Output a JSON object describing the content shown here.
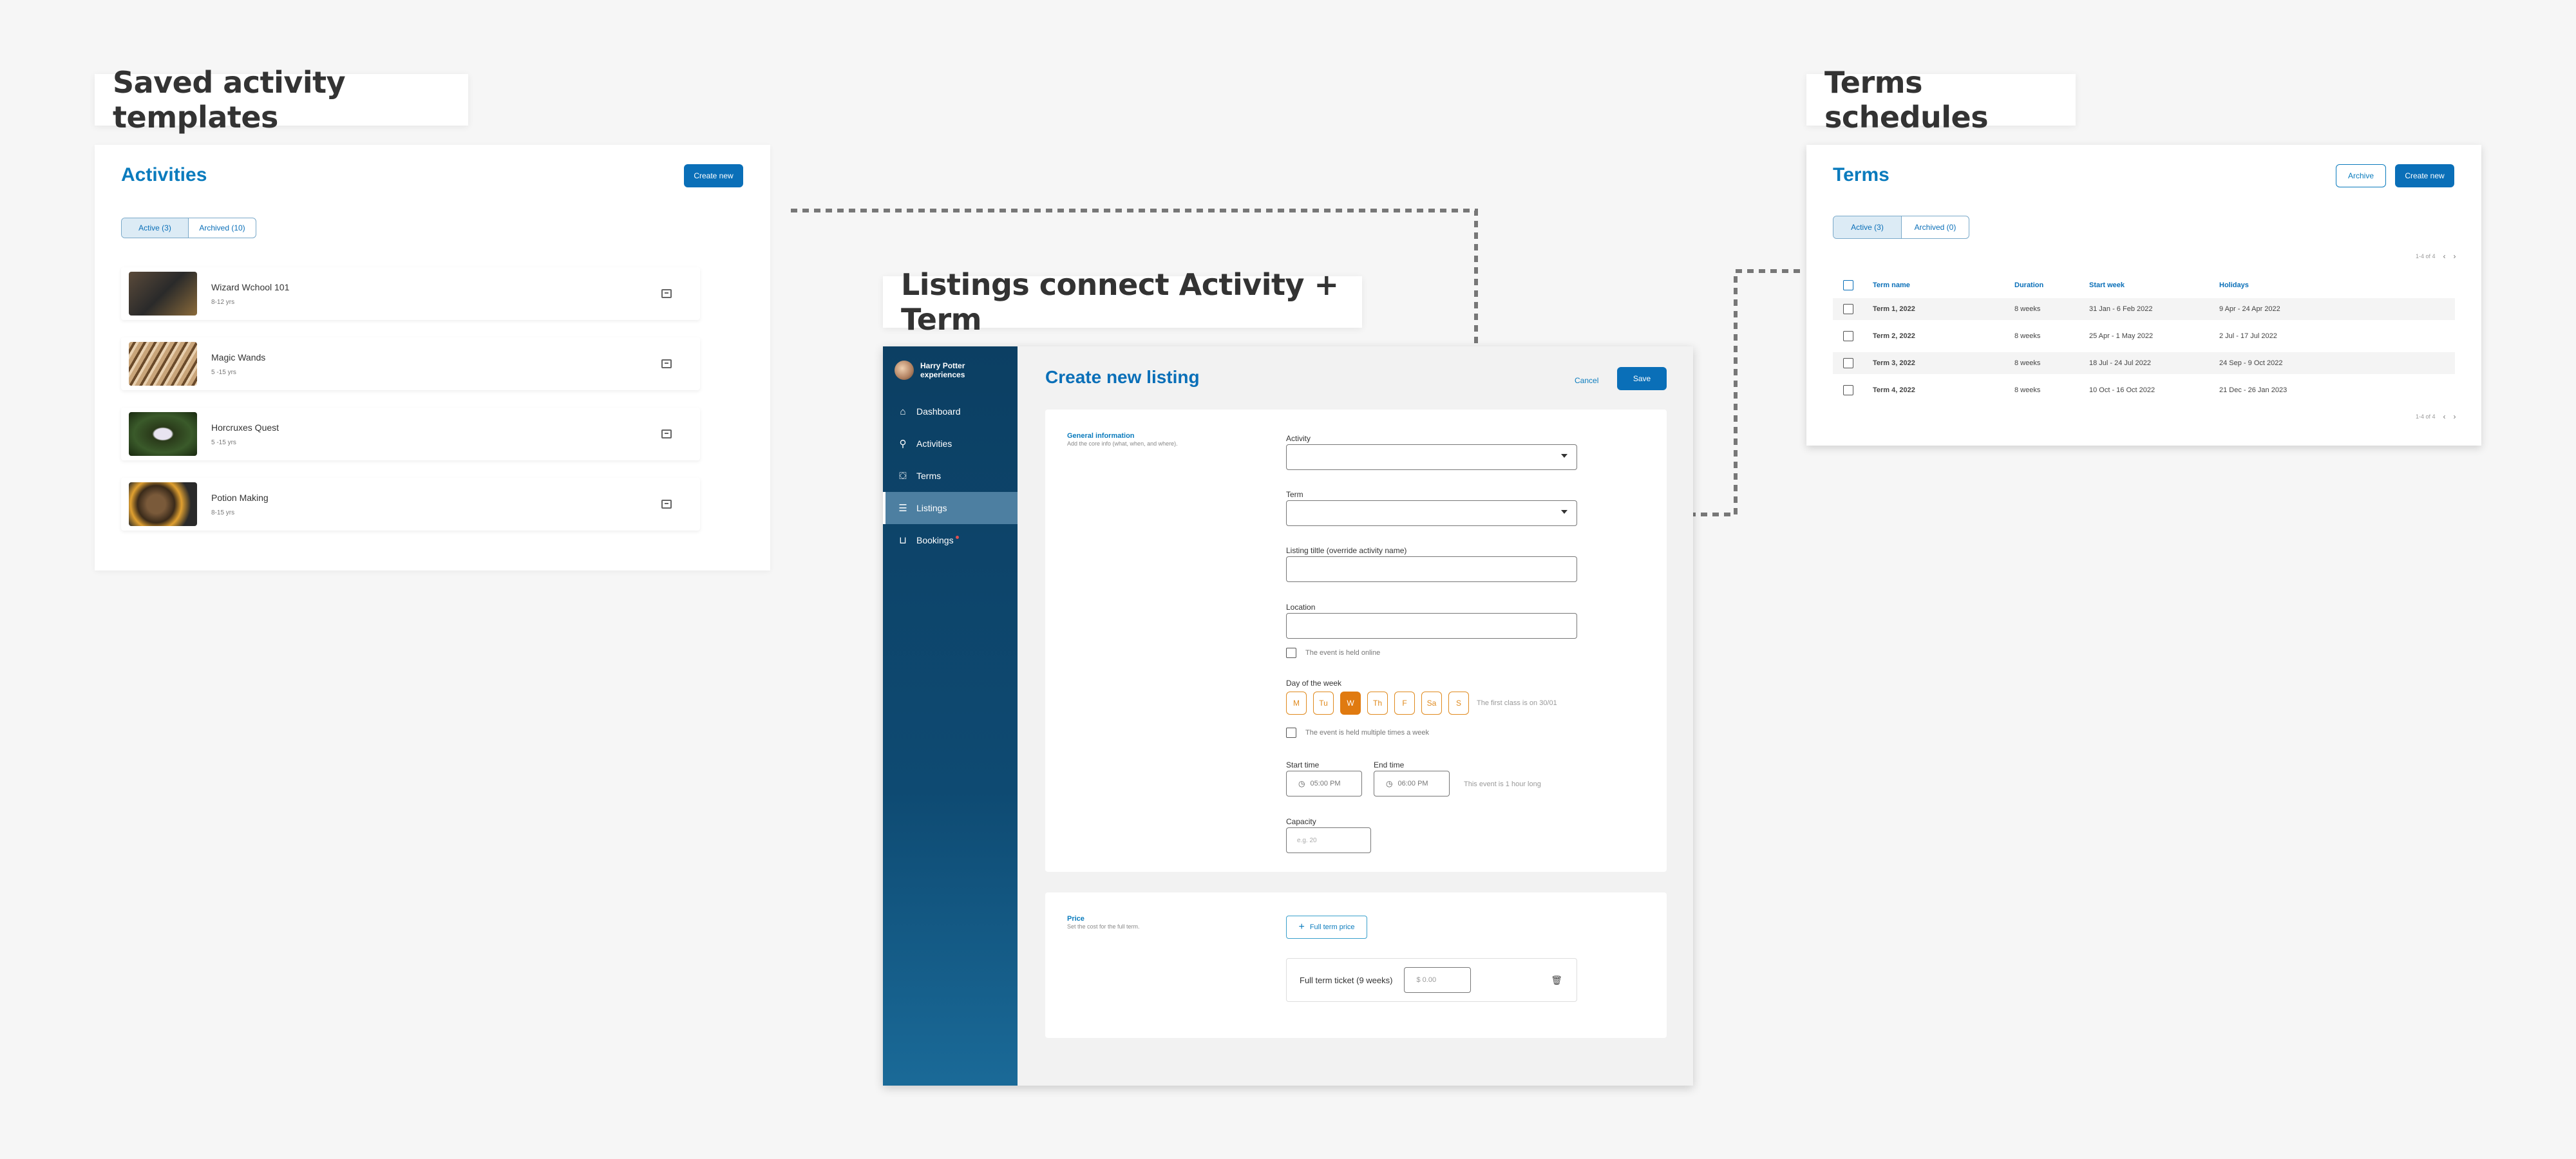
{
  "captions": {
    "activities": "Saved activity templates",
    "listings": "Listings connect Activity + Term",
    "terms": "Terms schedules"
  },
  "activities_panel": {
    "title": "Activities",
    "create_label": "Create new",
    "tabs": [
      "Active (3)",
      "Archived (10)"
    ],
    "items": [
      {
        "name": "Wizard Wchool 101",
        "age": "8-12 yrs"
      },
      {
        "name": "Magic Wands",
        "age": "5 -15 yrs"
      },
      {
        "name": "Horcruxes Quest",
        "age": "5 -15 yrs"
      },
      {
        "name": "Potion Making",
        "age": "8-15 yrs"
      }
    ]
  },
  "terms_panel": {
    "title": "Terms",
    "archive_label": "Archive",
    "create_label": "Create new",
    "tabs": [
      "Active (3)",
      "Archived (0)"
    ],
    "pagination": "1-4 of 4",
    "columns": [
      "Term name",
      "Duration",
      "Start week",
      "Holidays"
    ],
    "rows": [
      {
        "name": "Term 1, 2022",
        "duration": "8 weeks",
        "start": "31 Jan - 6 Feb 2022",
        "holidays": "9 Apr - 24 Apr 2022"
      },
      {
        "name": "Term 2, 2022",
        "duration": "8 weeks",
        "start": "25 Apr - 1 May 2022",
        "holidays": "2 Jul - 17 Jul 2022"
      },
      {
        "name": "Term 3, 2022",
        "duration": "8 weeks",
        "start": "18 Jul - 24 Jul 2022",
        "holidays": "24 Sep - 9 Oct 2022"
      },
      {
        "name": "Term 4, 2022",
        "duration": "8 weeks",
        "start": "10 Oct - 16 Oct 2022",
        "holidays": "21 Dec - 26 Jan 2023"
      }
    ]
  },
  "app": {
    "org_name": "Harry Potter experiences",
    "nav": [
      {
        "label": "Dashboard",
        "icon": "home-icon"
      },
      {
        "label": "Activities",
        "icon": "person-icon"
      },
      {
        "label": "Terms",
        "icon": "graduation-cap-icon"
      },
      {
        "label": "Listings",
        "icon": "list-icon"
      },
      {
        "label": "Bookings",
        "icon": "basket-icon"
      }
    ],
    "page_title": "Create new listing",
    "cancel_label": "Cancel",
    "save_label": "Save",
    "general": {
      "title": "General information",
      "desc": "Add the core info (what, when, and where).",
      "activity_label": "Activity",
      "term_label": "Term",
      "listing_title_label": "Listing tiltle (override activity name)",
      "location_label": "Location",
      "online_label": "The event is held online",
      "day_label": "Day of the week",
      "days": [
        "M",
        "Tu",
        "W",
        "Th",
        "F",
        "Sa",
        "S"
      ],
      "selected_day": "W",
      "first_class_hint": "The first class is on 30/01",
      "multiple_label": "The event is held multiple times a week",
      "start_time_label": "Start time",
      "start_time_value": "05:00 PM",
      "end_time_label": "End time",
      "end_time_value": "06:00 PM",
      "duration_hint": "This event is 1 hour long",
      "capacity_label": "Capacity",
      "capacity_placeholder": "e.g. 20"
    },
    "price": {
      "title": "Price",
      "desc": "Set the cost for the full term.",
      "add_label": "Full term price",
      "ticket_label": "Full term ticket (9 weeks)",
      "price_placeholder": "$ 0.00"
    }
  },
  "colors": {
    "accent": "#0a6fb8",
    "day_orange": "#e07a10",
    "sidebar": "#0c3f63"
  }
}
